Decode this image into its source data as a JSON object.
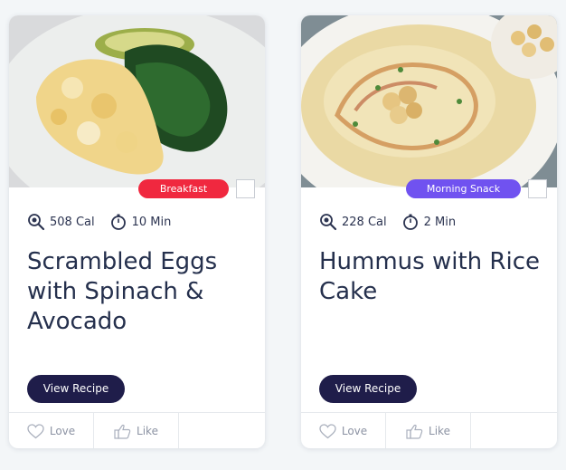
{
  "colors": {
    "breakfast_tag": "#f0283f",
    "snack_tag": "#7052f0",
    "button": "#1f1d4a",
    "title": "#25304d"
  },
  "cards": [
    {
      "image": "scrambled-eggs-spinach-avocado-photo",
      "tag": "Breakfast",
      "calories": "508 Cal",
      "time": "10 Min",
      "title": "Scrambled Eggs with Spinach & Avocado",
      "button": "View Recipe",
      "love": "Love",
      "like": "Like"
    },
    {
      "image": "hummus-bowl-photo",
      "tag": "Morning Snack",
      "calories": "228 Cal",
      "time": "2 Min",
      "title": "Hummus with Rice Cake",
      "button": "View Recipe",
      "love": "Love",
      "like": "Like"
    }
  ],
  "icons": {
    "calories": "magnifier-calorie-icon",
    "time": "stopwatch-icon",
    "love": "heart-icon",
    "like": "thumbs-up-icon"
  }
}
